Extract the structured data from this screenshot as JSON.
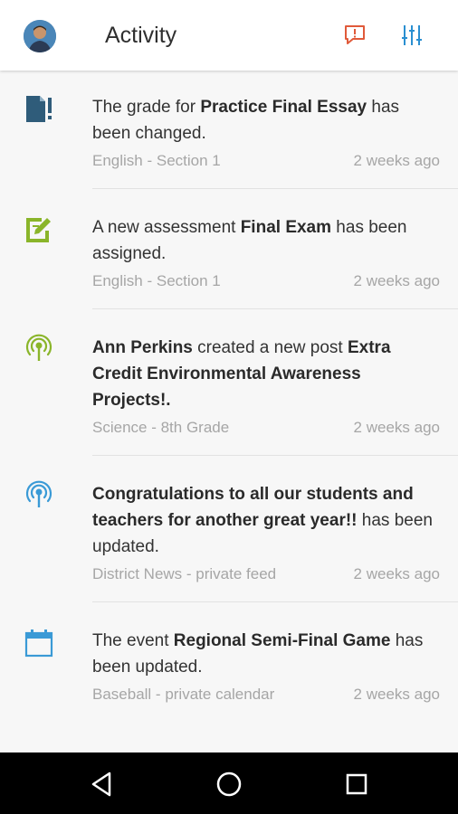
{
  "header": {
    "title": "Activity",
    "feedback_icon": "feedback-icon",
    "filter_icon": "filter-sliders-icon",
    "accent_feedback": "#e05a3a",
    "accent_filter": "#2a8fd1"
  },
  "feed": [
    {
      "icon": "grade-document-icon",
      "icon_color": "#2f5c7a",
      "parts": [
        {
          "text": "The grade for ",
          "bold": false
        },
        {
          "text": "Practice Final Essay",
          "bold": true
        },
        {
          "text": " has been changed.",
          "bold": false
        }
      ],
      "context": "English - Section 1",
      "time": "2 weeks ago"
    },
    {
      "icon": "assignment-edit-icon",
      "icon_color": "#8ab52a",
      "parts": [
        {
          "text": "A new assessment ",
          "bold": false
        },
        {
          "text": "Final Exam",
          "bold": true
        },
        {
          "text": " has been assigned.",
          "bold": false
        }
      ],
      "context": "English - Section 1",
      "time": "2 weeks ago"
    },
    {
      "icon": "broadcast-icon",
      "icon_color": "#8ab52a",
      "parts": [
        {
          "text": "Ann Perkins",
          "bold": true
        },
        {
          "text": " created a new post ",
          "bold": false
        },
        {
          "text": "Extra Credit Environmental Awareness Projects!.",
          "bold": true
        }
      ],
      "context": "Science - 8th Grade",
      "time": "2 weeks ago"
    },
    {
      "icon": "broadcast-icon",
      "icon_color": "#3a9ad6",
      "parts": [
        {
          "text": "Congratulations to all our students and teachers for another great year!!",
          "bold": true
        },
        {
          "text": " has been updated.",
          "bold": false
        }
      ],
      "context": "District News - private feed",
      "time": "2 weeks ago"
    },
    {
      "icon": "calendar-icon",
      "icon_color": "#3a9ad6",
      "parts": [
        {
          "text": "The event ",
          "bold": false
        },
        {
          "text": "Regional Semi-Final Game",
          "bold": true
        },
        {
          "text": " has been updated.",
          "bold": false
        }
      ],
      "context": "Baseball - private calendar",
      "time": "2 weeks ago"
    }
  ],
  "system_nav": {
    "back": "back-triangle-icon",
    "home": "home-circle-icon",
    "recents": "recents-square-icon"
  }
}
